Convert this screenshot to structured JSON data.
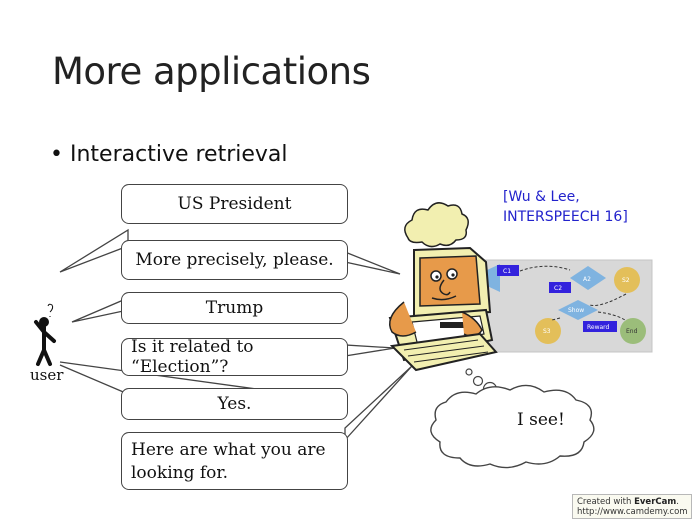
{
  "slide": {
    "title": "More applications",
    "bullet": "Interactive retrieval",
    "reference": {
      "line1": "[Wu & Lee,",
      "line2": "INTERSPEECH 16]"
    },
    "user_label": "user",
    "dialogue": [
      "US President",
      "More precisely, please.",
      "Trump",
      "Is it related to “Election”?",
      "Yes.",
      "Here are what you are",
      "looking for."
    ],
    "system_thought": "I see!",
    "flow_nodes": {
      "c1": "C1",
      "a2": "A2",
      "c2": "C2",
      "s2": "S2",
      "show": "Show",
      "reward": "Reward",
      "s3": "S3",
      "end": "End"
    }
  },
  "watermark": {
    "prefix": "Created with ",
    "brand": "EverCam",
    "suffix": ".",
    "url": "http://www.camdemy.com"
  },
  "colors": {
    "reference": "#2222cc",
    "flow_diamond": "#7fb3e0",
    "flow_box": "#3322dd",
    "flow_circle": "#e3bf5a",
    "flow_end": "#9bbd7a"
  }
}
